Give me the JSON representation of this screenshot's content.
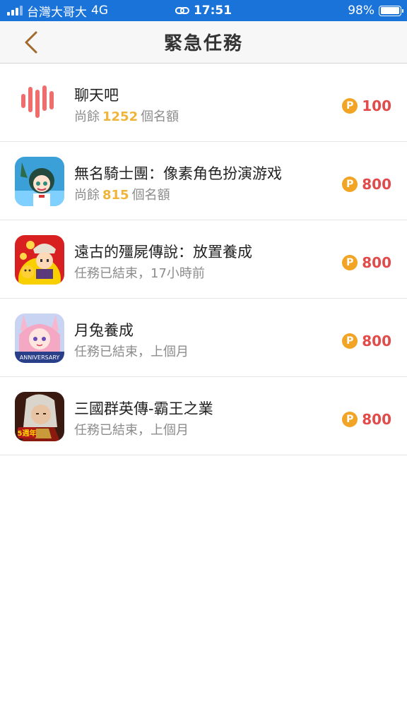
{
  "status_bar": {
    "carrier": "台灣大哥大",
    "network": "4G",
    "time": "17:51",
    "battery": "98%",
    "battery_level": 0.98
  },
  "nav": {
    "title": "緊急任務",
    "back_icon": "chevron-left-icon"
  },
  "colors": {
    "status_bar_bg": "#1a73d9",
    "accent_gold": "#f0b43a",
    "reward_red": "#e34b4b",
    "coin_orange": "#f2a425",
    "back_arrow": "#a06a2c"
  },
  "tasks": [
    {
      "name": "聊天吧",
      "sub_prefix": "尚餘",
      "sub_count": "1252",
      "sub_suffix": "個名額",
      "coin_label": "P",
      "reward": "100"
    },
    {
      "name": "無名騎士團：像素角色扮演游戏",
      "sub_prefix": "尚餘",
      "sub_count": "815",
      "sub_suffix": "個名額",
      "coin_label": "P",
      "reward": "800"
    },
    {
      "name": "遠古的殭屍傳說：放置養成",
      "sub_text": "任務已結束，17小時前",
      "coin_label": "P",
      "reward": "800"
    },
    {
      "name": "月兔養成",
      "sub_text": "任務已結束，上個月",
      "icon_caption": "ANNIVERSARY",
      "coin_label": "P",
      "reward": "800"
    },
    {
      "name": "三國群英傳-霸王之業",
      "sub_text": "任務已結束，上個月",
      "icon_caption": "5週年",
      "coin_label": "P",
      "reward": "800"
    }
  ]
}
